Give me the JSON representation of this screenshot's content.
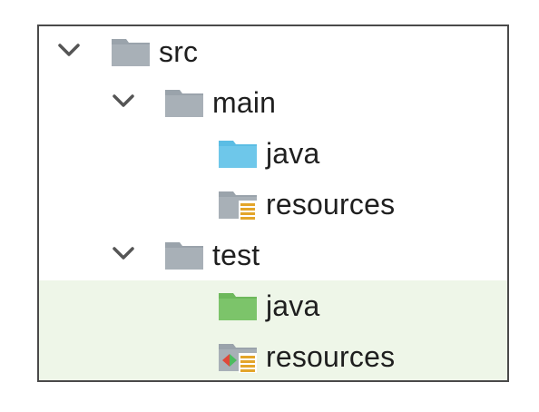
{
  "colors": {
    "panel_border": "#4a4a4a",
    "folder_gray": "#9aa3ab",
    "folder_source": "#6ec7ea",
    "folder_test": "#7cc46a",
    "resources_lines": "#e3a52a",
    "resources_test_red": "#e0483a",
    "resources_test_green": "#4dbb5f",
    "test_highlight": "#eef6e8"
  },
  "tree": {
    "src": {
      "label": "src",
      "icon": "folder-icon",
      "expanded": true
    },
    "main": {
      "label": "main",
      "icon": "folder-icon",
      "expanded": true
    },
    "main_java": {
      "label": "java",
      "icon": "source-root-folder-icon"
    },
    "main_resources": {
      "label": "resources",
      "icon": "resources-root-folder-icon"
    },
    "test": {
      "label": "test",
      "icon": "folder-icon",
      "expanded": true
    },
    "test_java": {
      "label": "java",
      "icon": "test-source-root-folder-icon"
    },
    "test_resources": {
      "label": "resources",
      "icon": "test-resources-root-folder-icon"
    }
  }
}
